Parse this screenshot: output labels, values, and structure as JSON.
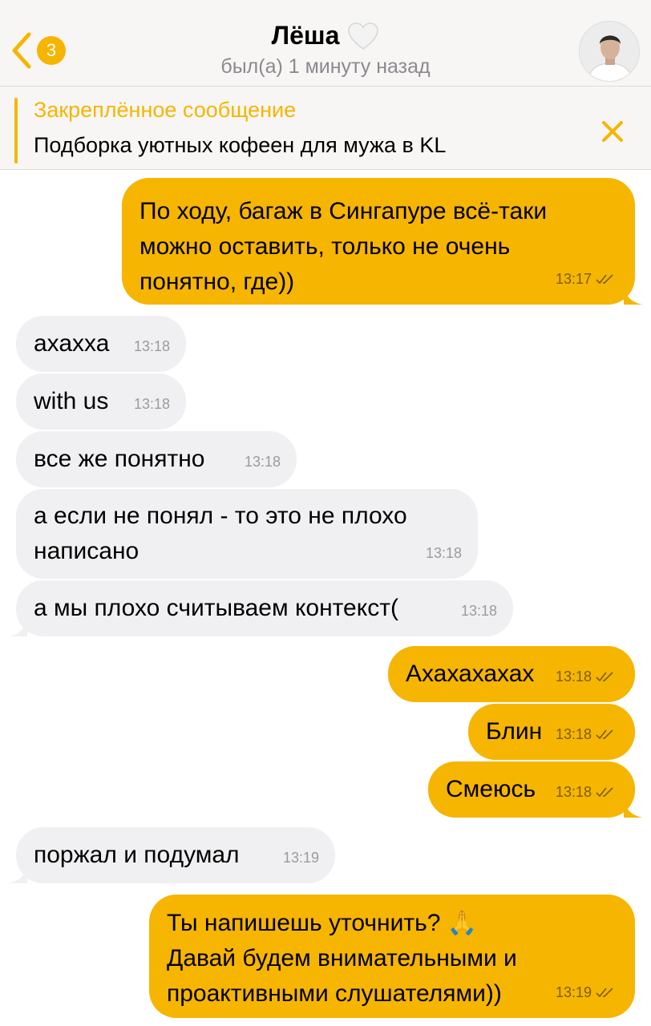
{
  "header": {
    "back_count": "3",
    "contact_name": "Лёша",
    "status": "был(а) 1 минуту назад"
  },
  "pinned": {
    "title": "Закреплённое сообщение",
    "text": "Подборка уютных кофеен для мужа в KL"
  },
  "colors": {
    "accent": "#f6b500",
    "incoming_bubble": "#f0f0f2"
  },
  "messages": [
    {
      "dir": "out",
      "text": "По ходу, багаж в Сингапуре всё-таки\nможно оставить, только не очень\nпонятно, где))",
      "time": "13:17"
    },
    {
      "dir": "in",
      "text": "ахахха",
      "time": "13:18"
    },
    {
      "dir": "in",
      "text": "with us",
      "time": "13:18"
    },
    {
      "dir": "in",
      "text": "все же понятно",
      "time": "13:18"
    },
    {
      "dir": "in",
      "text": "а если не понял - то это не плохо\nнаписано",
      "time": "13:18"
    },
    {
      "dir": "in",
      "text": "а мы плохо считываем контекст(",
      "time": "13:18"
    },
    {
      "dir": "out",
      "text": "Ахахахахах",
      "time": "13:18"
    },
    {
      "dir": "out",
      "text": "Блин",
      "time": "13:18"
    },
    {
      "dir": "out",
      "text": "Смеюсь",
      "time": "13:18"
    },
    {
      "dir": "in",
      "text": "поржал и подумал",
      "time": "13:19"
    },
    {
      "dir": "out",
      "text": "Ты напишешь уточнить? 🙏\nДавай будем внимательными и\nпроактивными слушателями))",
      "time": "13:19"
    }
  ]
}
